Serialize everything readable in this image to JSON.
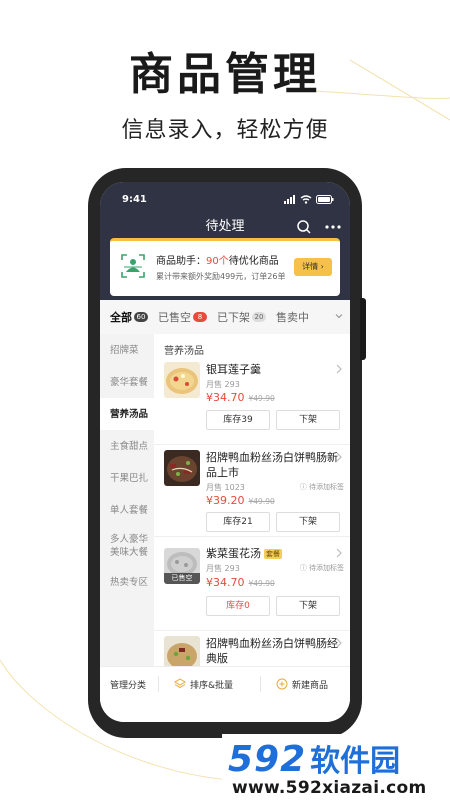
{
  "promo": {
    "headline": "商品管理",
    "subline": "信息录入，轻松方便"
  },
  "status_bar": {
    "time": "9:41"
  },
  "nav": {
    "title": "待处理",
    "search_icon": "search-icon",
    "more_icon": "more-icon"
  },
  "assistant": {
    "prefix": "商品助手：",
    "count": "90个",
    "suffix": "待优化商品",
    "subtitle": "累计带来额外奖励499元，订单26单",
    "button": "详情"
  },
  "tabs": [
    {
      "label": "全部",
      "badge": "60"
    },
    {
      "label": "已售空",
      "badge": "8"
    },
    {
      "label": "已下架",
      "badge": "20"
    },
    {
      "label": "售卖中",
      "badge": ""
    }
  ],
  "categories": [
    "招牌菜",
    "豪华套餐",
    "营养汤品",
    "主食甜点",
    "干果巴扎",
    "单人套餐",
    "多人豪华美味大餐",
    "热卖专区"
  ],
  "section_title": "营养汤品",
  "items": [
    {
      "name": "银耳莲子羹",
      "tag": "",
      "sales": "月售 293",
      "pending": "",
      "price": "¥34.70",
      "old_price": "¥49.90",
      "stock": "库存39",
      "off": "下架",
      "sold_out": ""
    },
    {
      "name": "招牌鸭血粉丝汤白饼鸭肠新品上市",
      "tag": "",
      "sales": "月售 1023",
      "pending": "待添加标签",
      "price": "¥39.20",
      "old_price": "¥49.90",
      "stock": "库存21",
      "off": "下架",
      "sold_out": ""
    },
    {
      "name": "紫菜蛋花汤",
      "tag": "套餐",
      "sales": "月售 293",
      "pending": "待添加标签",
      "price": "¥34.70",
      "old_price": "¥49.90",
      "stock": "库存0",
      "off": "下架",
      "sold_out": "已售空"
    },
    {
      "name": "招牌鸭血粉丝汤白饼鸭肠经典版",
      "tag": "",
      "sales": "",
      "pending": "",
      "price": "",
      "old_price": "",
      "stock": "",
      "off": "",
      "sold_out": ""
    }
  ],
  "bottom_bar": {
    "manage": "管理分类",
    "sort": "排序&批量",
    "new": "新建商品"
  },
  "watermark": {
    "number": "592",
    "name": "软件园",
    "url": "www.592xiazai.com"
  },
  "colors": {
    "accent_red": "#e54b3c",
    "topbar": "#2f3343",
    "assist_yellow": "#f6c14b",
    "logo_blue": "#1e6fd9"
  }
}
